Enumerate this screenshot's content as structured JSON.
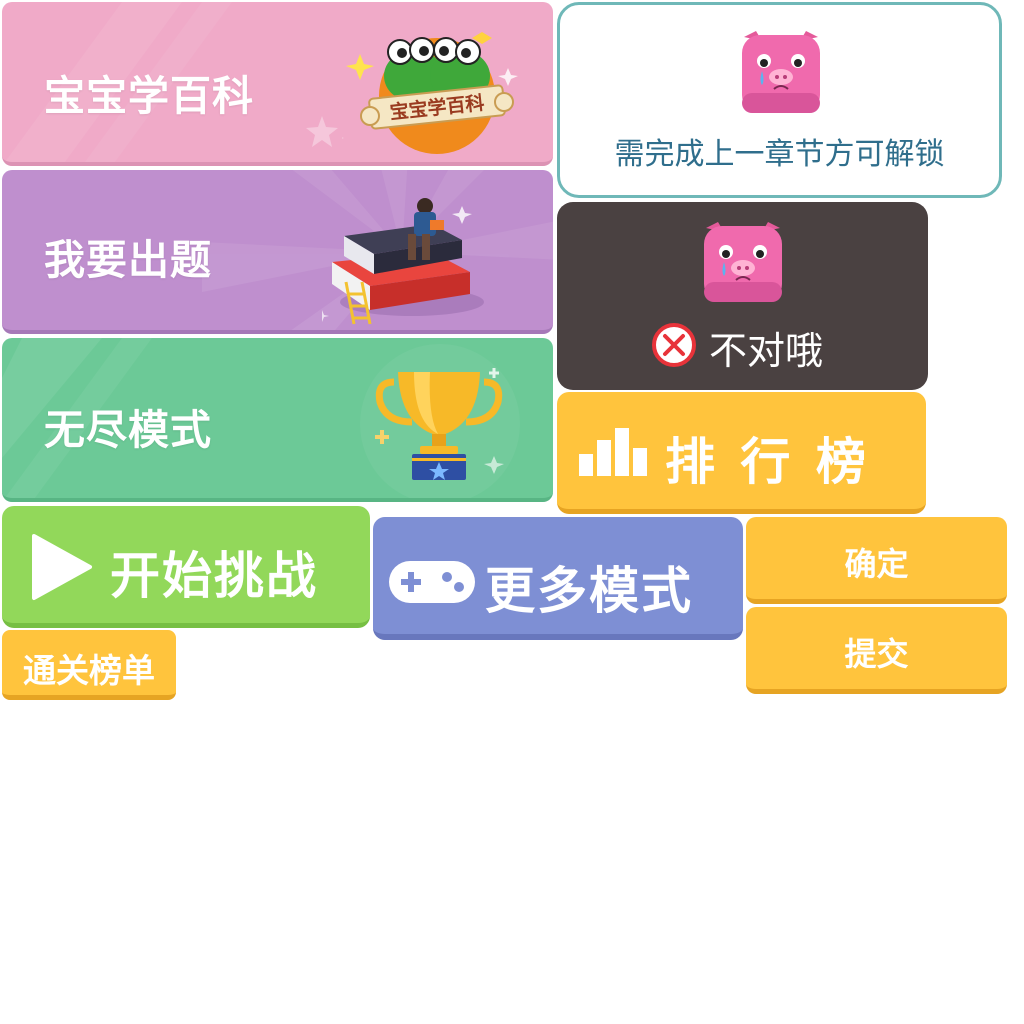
{
  "cards": {
    "encyclopedia": {
      "title": "宝宝学百科",
      "logo_text": "宝宝学百科",
      "color": "#f0aac8"
    },
    "create_question": {
      "title": "我要出题",
      "color": "#bf8fce"
    },
    "endless_mode": {
      "title": "无尽模式",
      "color": "#6cc997"
    }
  },
  "lock_panel": {
    "message": "需完成上一章节方可解锁",
    "border_color": "#6fb8b8",
    "text_color": "#2f6e8c",
    "icon": "crying-pig-icon"
  },
  "wrong_panel": {
    "message": "不对哦",
    "bg_color": "#4a4141",
    "icon": "crying-pig-icon",
    "status_icon": "x-circle-icon"
  },
  "buttons": {
    "leaderboard": {
      "label": "排 行 榜",
      "icon": "bar-chart-icon",
      "color": "#ffc43d"
    },
    "start": {
      "label": "开始挑战",
      "icon": "play-icon",
      "color": "#92d85a"
    },
    "more_modes": {
      "label": "更多模式",
      "icon": "gamepad-icon",
      "color": "#7e8fd4"
    },
    "confirm": {
      "label": "确定",
      "color": "#ffc43d"
    },
    "submit": {
      "label": "提交",
      "color": "#ffc43d"
    },
    "clear_list": {
      "label": "通关榜单",
      "color": "#ffc43d"
    }
  }
}
